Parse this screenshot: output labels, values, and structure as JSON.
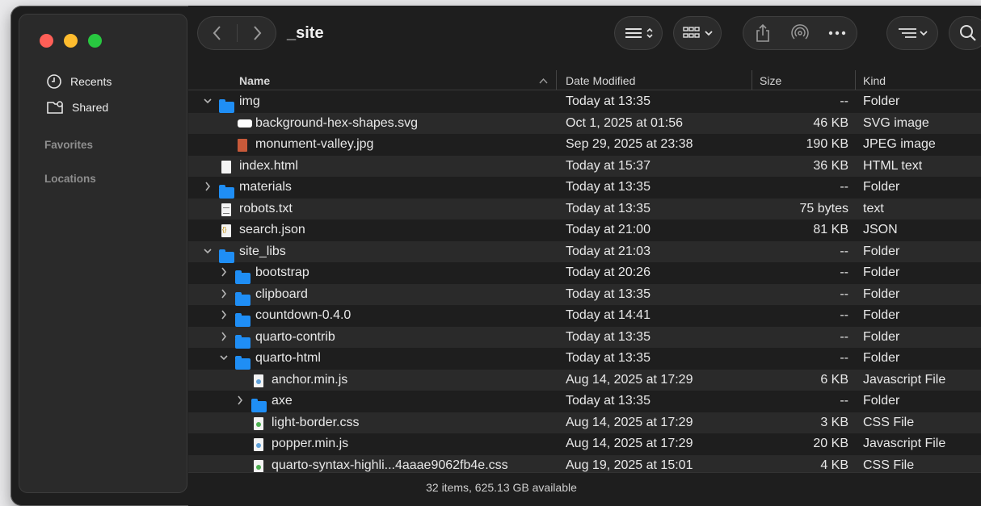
{
  "window": {
    "title": "_site"
  },
  "sidebar": {
    "items": [
      {
        "label": "Recents",
        "icon": "clock-icon"
      },
      {
        "label": "Shared",
        "icon": "shared-folder-icon"
      }
    ],
    "sections": [
      "Favorites",
      "Locations"
    ]
  },
  "toolbar": {
    "back_icon": "chevron-left-icon",
    "forward_icon": "chevron-right-icon",
    "view_icon": "list-view-icon",
    "group_icon": "grid-group-icon",
    "share_icon": "share-icon",
    "airdrop_icon": "airdrop-icon",
    "more_icon": "more-icon",
    "sort_icon": "sort-options-icon",
    "search_icon": "search-icon"
  },
  "columns": {
    "name": "Name",
    "date": "Date Modified",
    "size": "Size",
    "kind": "Kind"
  },
  "rows": [
    {
      "name": "img",
      "date": "Today at 13:35",
      "size": "--",
      "kind": "Folder",
      "icon": "folder",
      "indent": 0,
      "chevron": "down"
    },
    {
      "name": "background-hex-shapes.svg",
      "date": "Oct 1, 2025 at 01:56",
      "size": "46 KB",
      "kind": "SVG image",
      "icon": "svg",
      "indent": 1,
      "chevron": ""
    },
    {
      "name": "monument-valley.jpg",
      "date": "Sep 29, 2025 at 23:38",
      "size": "190 KB",
      "kind": "JPEG image",
      "icon": "jpg",
      "indent": 1,
      "chevron": ""
    },
    {
      "name": "index.html",
      "date": "Today at 15:37",
      "size": "36 KB",
      "kind": "HTML text",
      "icon": "doc",
      "indent": 0,
      "chevron": ""
    },
    {
      "name": "materials",
      "date": "Today at 13:35",
      "size": "--",
      "kind": "Folder",
      "icon": "folder",
      "indent": 0,
      "chevron": "right"
    },
    {
      "name": "robots.txt",
      "date": "Today at 13:35",
      "size": "75 bytes",
      "kind": "text",
      "icon": "txt",
      "indent": 0,
      "chevron": ""
    },
    {
      "name": "search.json",
      "date": "Today at 21:00",
      "size": "81 KB",
      "kind": "JSON",
      "icon": "json",
      "indent": 0,
      "chevron": ""
    },
    {
      "name": "site_libs",
      "date": "Today at 21:03",
      "size": "--",
      "kind": "Folder",
      "icon": "folder",
      "indent": 0,
      "chevron": "down"
    },
    {
      "name": "bootstrap",
      "date": "Today at 20:26",
      "size": "--",
      "kind": "Folder",
      "icon": "folder",
      "indent": 1,
      "chevron": "right"
    },
    {
      "name": "clipboard",
      "date": "Today at 13:35",
      "size": "--",
      "kind": "Folder",
      "icon": "folder",
      "indent": 1,
      "chevron": "right"
    },
    {
      "name": "countdown-0.4.0",
      "date": "Today at 14:41",
      "size": "--",
      "kind": "Folder",
      "icon": "folder",
      "indent": 1,
      "chevron": "right"
    },
    {
      "name": "quarto-contrib",
      "date": "Today at 13:35",
      "size": "--",
      "kind": "Folder",
      "icon": "folder",
      "indent": 1,
      "chevron": "right"
    },
    {
      "name": "quarto-html",
      "date": "Today at 13:35",
      "size": "--",
      "kind": "Folder",
      "icon": "folder",
      "indent": 1,
      "chevron": "down"
    },
    {
      "name": "anchor.min.js",
      "date": "Aug 14, 2025 at 17:29",
      "size": "6 KB",
      "kind": "Javascript File",
      "icon": "js",
      "indent": 2,
      "chevron": ""
    },
    {
      "name": "axe",
      "date": "Today at 13:35",
      "size": "--",
      "kind": "Folder",
      "icon": "folder",
      "indent": 2,
      "chevron": "right"
    },
    {
      "name": "light-border.css",
      "date": "Aug 14, 2025 at 17:29",
      "size": "3 KB",
      "kind": "CSS File",
      "icon": "css",
      "indent": 2,
      "chevron": ""
    },
    {
      "name": "popper.min.js",
      "date": "Aug 14, 2025 at 17:29",
      "size": "20 KB",
      "kind": "Javascript File",
      "icon": "js",
      "indent": 2,
      "chevron": ""
    },
    {
      "name": "quarto-syntax-highli...4aaae9062fb4e.css",
      "date": "Aug 19, 2025 at 15:01",
      "size": "4 KB",
      "kind": "CSS File",
      "icon": "css",
      "indent": 2,
      "chevron": ""
    }
  ],
  "status": {
    "text": "32 items, 625.13 GB available"
  }
}
